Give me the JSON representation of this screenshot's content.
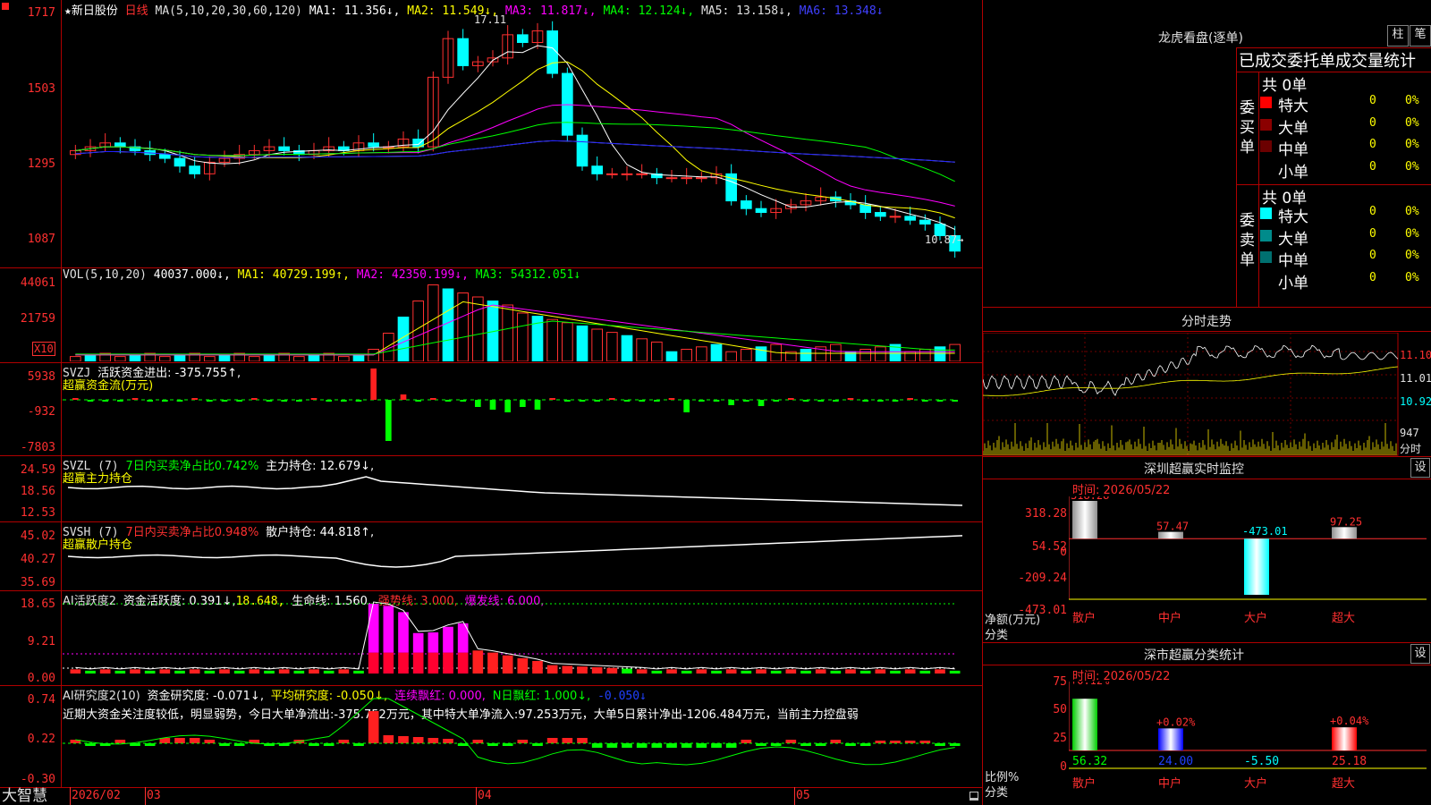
{
  "bottom_bar": {
    "brand": "大智慧",
    "dates": [
      "2026/02",
      "03",
      "04",
      "05"
    ]
  },
  "main": {
    "star": "★",
    "stock_name": "新日股份",
    "period": "日线",
    "ma_params": "MA(5,10,20,30,60,120)",
    "ma1": "MA1: 11.356↓,",
    "ma2": "MA2: 11.549↓,",
    "ma3": "MA3: 11.817↓,",
    "ma4": "MA4: 12.124↓,",
    "ma5": "MA5: 13.158↓,",
    "ma6": "MA6: 13.348↓",
    "y_labels": [
      "1717",
      "1503",
      "1295",
      "1087"
    ],
    "high_marker": "17.11",
    "low_marker": "10.87→",
    "colors": {
      "ma1": "#ffffff",
      "ma2": "#ffff00",
      "ma3": "#ff00ff",
      "ma4": "#00ff00",
      "ma5": "#c0c0c0",
      "ma6": "#2020ff",
      "up": "#ff3030",
      "down": "#00ffff"
    }
  },
  "vol": {
    "title": "VOL(5,10,20)",
    "v": "40037.000↓,",
    "ma1": "MA1: 40729.199↑,",
    "ma2": "MA2: 42350.199↓,",
    "ma3": "MA3: 54312.051↓",
    "y_labels": [
      "44061",
      "21759"
    ],
    "unit": "X10"
  },
  "svzj": {
    "title": "SVZJ",
    "text": "活跃资金进出: -375.755↑,",
    "subtitle": "超赢资金流(万元)",
    "y_labels": [
      "5938",
      "-932",
      "-7803"
    ]
  },
  "svzl": {
    "title": "SVZL (7)",
    "ratio": "7日内买卖净占比0.742%",
    "hold": "主力持仓: 12.679↓,",
    "subtitle": "超赢主力持仓",
    "y_labels": [
      "24.59",
      "18.56",
      "12.53"
    ]
  },
  "svsh": {
    "title": "SVSH (7)",
    "ratio": "7日内买卖净占比0.948%",
    "hold": "散户持仓: 44.818↑,",
    "subtitle": "超赢散户持仓",
    "y_labels": [
      "45.02",
      "40.27",
      "35.69"
    ]
  },
  "ai_active": {
    "title": "AI活跃度2",
    "a": "资金活跃度: 0.391↓,",
    "b": "18.648,",
    "c": "生命线: 1.560,",
    "d": "强势线: 3.000,",
    "e": "爆发线: 6.000,",
    "y_labels": [
      "18.65",
      "9.21",
      "0.00"
    ]
  },
  "ai_research": {
    "title": "AI研究度2(10)",
    "a": "资金研究度: -0.071↓,",
    "b": "平均研究度: -0.050↓,",
    "c": "连续飘红: 0.000,",
    "d": "N日飘红: 1.000↓,",
    "e": "-0.050↓",
    "comment": "近期大资金关注度较低，明显弱势，今日大单净流出:-375.752万元，其中特大单净流入:97.253万元，大单5日累计净出-1206.484万元，当前主力控盘弱",
    "y_labels": [
      "0.74",
      "0.22",
      "-0.30"
    ]
  },
  "dragon": {
    "title": "龙虎看盘(逐单)",
    "btn1": "柱",
    "btn2": "笔",
    "header": "已成交委托单成交量统计",
    "buy_label": "委买单",
    "sell_label": "委卖单",
    "buy_total": "共 0单",
    "sell_total": "共 0单",
    "rows_buy": [
      {
        "name": "特大",
        "count": "0",
        "pct": "0%",
        "color": "#ff0000"
      },
      {
        "name": "大单",
        "count": "0",
        "pct": "0%",
        "color": "#8b0000"
      },
      {
        "name": "中单",
        "count": "0",
        "pct": "0%",
        "color": "#6b0000"
      },
      {
        "name": "小单",
        "count": "0",
        "pct": "0%",
        "color": ""
      }
    ],
    "rows_sell": [
      {
        "name": "特大",
        "count": "0",
        "pct": "0%",
        "color": "#00ffff"
      },
      {
        "name": "大单",
        "count": "0",
        "pct": "0%",
        "color": "#008b8b"
      },
      {
        "name": "中单",
        "count": "0",
        "pct": "0%",
        "color": "#007070"
      },
      {
        "name": "小单",
        "count": "0",
        "pct": "0%",
        "color": ""
      }
    ]
  },
  "minute": {
    "title": "分时走势",
    "y_labels": [
      "11.10",
      "11.01",
      "10.92"
    ],
    "vol_label": "947",
    "sub_label": "分时"
  },
  "sz_monitor": {
    "title": "深圳超赢实时监控",
    "btn": "设",
    "time": "时间: 2026/05/22",
    "y_labels": [
      "318.28",
      "54.52",
      "0",
      "-209.24",
      "-473.01"
    ],
    "ylabel": "净额(万元)",
    "xlabel": "分类"
  },
  "sz_class": {
    "title": "深市超赢分类统计",
    "btn": "设",
    "time": "时间: 2026/05/22",
    "y_labels": [
      "75",
      "50",
      "25",
      "0"
    ],
    "ylabel": "比例%",
    "xlabel": "分类"
  },
  "chart_data": [
    {
      "type": "candlestick",
      "title": "新日股份 日线",
      "note": "approximate daily OHLC read from axis (price ×0.01 scale labels 1087–1717)",
      "x": [
        "2026/02",
        "",
        "",
        "",
        "",
        "",
        "",
        "",
        "",
        "",
        "",
        "",
        "",
        "",
        "",
        "",
        "",
        "",
        "",
        "",
        "",
        "",
        "",
        "",
        "",
        "",
        "",
        "",
        "03",
        "",
        "",
        "",
        "",
        "",
        "",
        "",
        "",
        "",
        "",
        "",
        "",
        "04",
        "",
        "",
        "",
        "",
        "",
        "",
        "",
        "",
        "",
        "",
        "",
        "",
        "",
        "",
        "",
        "",
        "",
        "",
        "05",
        "",
        "",
        "",
        "",
        "",
        "",
        "",
        "",
        "",
        "",
        "",
        "",
        "",
        "",
        ""
      ],
      "ylim": [
        10.5,
        17.4
      ],
      "ohlc_close_approx": [
        13.5,
        13.6,
        13.7,
        13.6,
        13.5,
        13.4,
        13.3,
        13.1,
        12.9,
        13.2,
        13.3,
        13.4,
        13.5,
        13.6,
        13.5,
        13.4,
        13.5,
        13.6,
        13.5,
        13.7,
        13.6,
        13.6,
        13.8,
        13.6,
        15.4,
        16.4,
        15.7,
        15.8,
        15.9,
        16.5,
        16.3,
        16.6,
        15.5,
        13.9,
        13.1,
        12.9,
        12.9,
        12.9,
        12.9,
        12.8,
        12.8,
        12.8,
        12.8,
        12.9,
        12.2,
        12.0,
        11.9,
        12.0,
        12.1,
        12.2,
        12.3,
        12.2,
        12.1,
        11.9,
        11.8,
        11.8,
        11.7,
        11.6,
        11.3,
        10.9
      ]
    },
    {
      "type": "bar",
      "title": "VOL(5,10,20)",
      "series": [
        {
          "name": "VOL",
          "values": [
            40037
          ]
        },
        {
          "name": "MA1",
          "values": [
            40729.199
          ]
        },
        {
          "name": "MA2",
          "values": [
            42350.199
          ]
        },
        {
          "name": "MA3",
          "values": [
            54312.051
          ]
        }
      ]
    },
    {
      "type": "bar",
      "title": "深圳超赢实时监控",
      "categories": [
        "散户",
        "中户",
        "大户",
        "超大"
      ],
      "values": [
        318.28,
        57.47,
        -473.01,
        97.25
      ],
      "ylim": [
        -473.01,
        318.28
      ]
    },
    {
      "type": "bar",
      "title": "深市超赢分类统计",
      "categories": [
        "散户",
        "中户",
        "大户",
        "超大"
      ],
      "values": [
        56.32,
        24.0,
        -5.5,
        25.18
      ],
      "top_labels": [
        "+0.12%",
        "+0.02%",
        "",
        "+0.04%"
      ],
      "ylim": [
        0,
        75
      ]
    }
  ]
}
